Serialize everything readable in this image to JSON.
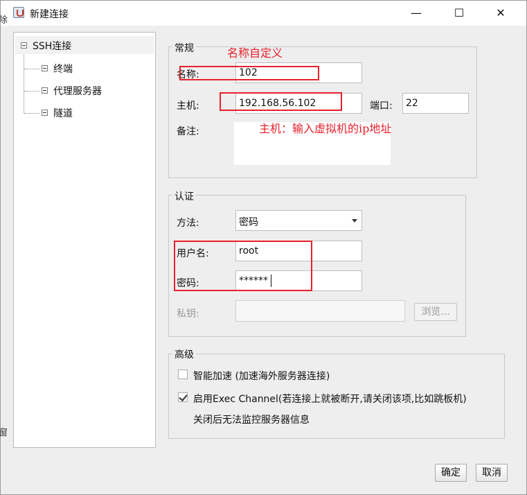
{
  "window": {
    "title": "新建连接",
    "minimize_glyph": "—",
    "maximize_glyph": "☐",
    "close_glyph": "✕",
    "app_icon": "java-cup-icon"
  },
  "background_leak": {
    "left_top": "除",
    "left_bottom": "窗"
  },
  "tree": {
    "root": "SSH连接",
    "children": [
      "终端",
      "代理服务器",
      "隧道"
    ]
  },
  "general": {
    "title": "常规",
    "name_label": "名称:",
    "name_value": "102",
    "host_label": "主机:",
    "host_value": "192.168.56.102",
    "port_label": "端口:",
    "port_value": "22",
    "note_label": "备注:",
    "note_value": ""
  },
  "auth": {
    "title": "认证",
    "method_label": "方法:",
    "method_value": "密码",
    "username_label": "用户名:",
    "username_value": "root",
    "password_label": "密码:",
    "password_value": "******",
    "private_key_label": "私钥:",
    "private_key_value": "",
    "browse_button": "浏览..."
  },
  "advanced": {
    "title": "高级",
    "smart_accel_label": "智能加速 (加速海外服务器连接)",
    "smart_accel_checked": false,
    "exec_channel_label": "启用Exec Channel(若连接上就被断开,请关闭该项,比如跳板机)",
    "exec_channel_checked": true,
    "exec_channel_note": "关闭后无法监控服务器信息"
  },
  "buttons": {
    "ok": "确定",
    "cancel": "取消"
  },
  "annotations": {
    "name_hint": "名称自定义",
    "host_hint": "主机：输入虚拟机的ip地址",
    "highlight_color": "#e8202b"
  }
}
